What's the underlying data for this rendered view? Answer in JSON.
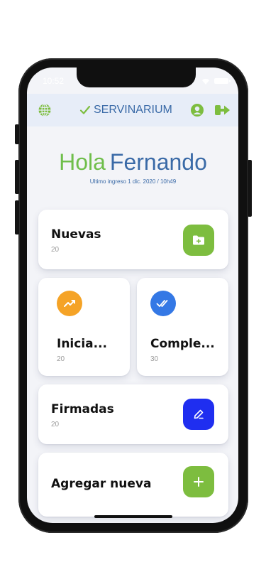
{
  "status": {
    "time": "10:52"
  },
  "header": {
    "brand": "SERVINARIUM"
  },
  "greeting": {
    "hola": "Hola",
    "name": "Fernando",
    "last_login": "Ultimo ingreso 1 dic. 2020 / 10h49"
  },
  "cards": {
    "nuevas": {
      "title": "Nuevas",
      "count": "20"
    },
    "iniciadas": {
      "title": "Inicia...",
      "count": "20"
    },
    "completadas": {
      "title": "Comple...",
      "count": "30"
    },
    "firmadas": {
      "title": "Firmadas",
      "count": "20"
    },
    "agregar": {
      "title": "Agregar nueva"
    }
  },
  "colors": {
    "green": "#7dbd3f",
    "orange": "#f5a326",
    "blue": "#3478e5",
    "indigo": "#1f2ef0",
    "brand_blue": "#3a6aa7",
    "brand_green": "#6fbe4b"
  },
  "icons": {
    "header": [
      "globe-icon",
      "check-icon",
      "user-icon",
      "logout-icon"
    ],
    "cards": [
      "folder-plus-icon",
      "trend-up-icon",
      "double-check-icon",
      "pen-icon",
      "plus-icon"
    ]
  }
}
